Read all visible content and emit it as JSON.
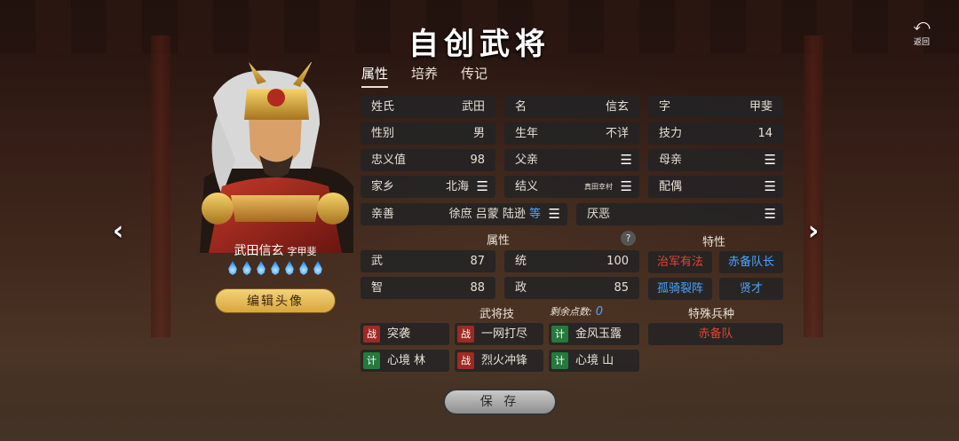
{
  "header": {
    "title": "自创武将",
    "back_label": "返回"
  },
  "hero": {
    "name": "武田信玄",
    "courtesy_label": "字甲斐",
    "star_count": 7,
    "edit_label": "编辑头像"
  },
  "tabs": [
    {
      "label": "属性"
    },
    {
      "label": "培养"
    },
    {
      "label": "传记"
    }
  ],
  "info": {
    "surname": {
      "label": "姓氏",
      "value": "武田"
    },
    "given": {
      "label": "名",
      "value": "信玄"
    },
    "courtesy": {
      "label": "字",
      "value": "甲斐"
    },
    "gender": {
      "label": "性别",
      "value": "男"
    },
    "birth": {
      "label": "生年",
      "value": "不详"
    },
    "skill_power": {
      "label": "技力",
      "value": "14"
    },
    "loyalty": {
      "label": "忠义值",
      "value": "98"
    },
    "father": {
      "label": "父亲"
    },
    "mother": {
      "label": "母亲"
    },
    "hometown": {
      "label": "家乡",
      "value": "北海"
    },
    "sworn": {
      "label": "结义",
      "value": "真田幸村"
    },
    "spouse": {
      "label": "配偶"
    },
    "friends": {
      "label": "亲善",
      "value": "徐庶 吕蒙 陆逊 ",
      "more": "等"
    },
    "dislike": {
      "label": "厌恶"
    }
  },
  "attributes": {
    "section_label": "属性",
    "help": "?",
    "wu": {
      "label": "武",
      "value": "87"
    },
    "tong": {
      "label": "统",
      "value": "100"
    },
    "zhi": {
      "label": "智",
      "value": "88"
    },
    "zheng": {
      "label": "政",
      "value": "85"
    }
  },
  "traits": {
    "section_label": "特性",
    "items": [
      "治军有法",
      "赤备队长",
      "孤骑裂阵",
      "贤才"
    ]
  },
  "skills": {
    "section_label": "武将技",
    "remaining_label": "剩余点数:",
    "remaining_value": "0",
    "items": [
      {
        "tag": "战",
        "name": "突袭"
      },
      {
        "tag": "战",
        "name": "一网打尽"
      },
      {
        "tag": "计",
        "name": "金风玉露"
      },
      {
        "tag": "计",
        "name": "心境 林"
      },
      {
        "tag": "战",
        "name": "烈火冲锋"
      },
      {
        "tag": "计",
        "name": "心境 山"
      }
    ]
  },
  "special_troop": {
    "section_label": "特殊兵种",
    "value": "赤备队"
  },
  "actions": {
    "save_label": "保 存"
  },
  "colors": {
    "red_text": "#e0452b",
    "blue_text": "#4aa3ff",
    "gold_button": "#d9a63c"
  },
  "icons": {
    "back": "back-arrow-icon",
    "menu": "list-menu-icon",
    "prev": "chevron-left-icon",
    "next": "chevron-right-icon"
  }
}
